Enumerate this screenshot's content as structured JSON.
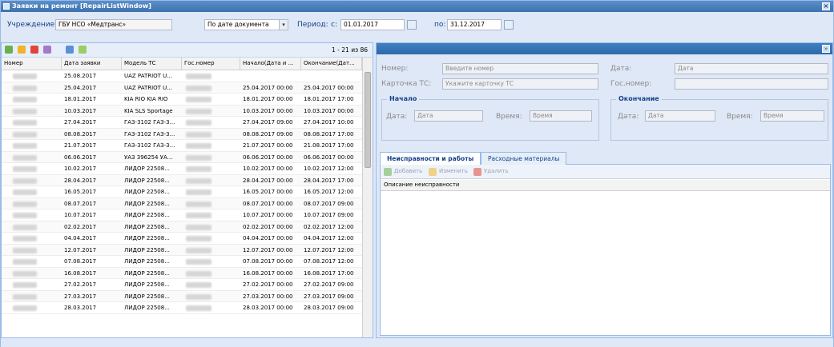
{
  "window": {
    "title": "Заявки на ремонт [RepairListWindow]"
  },
  "filter": {
    "institution_label": "Учреждение:",
    "institution_value": "ГБУ НСО «Медтранс»",
    "date_mode": "По дате документа",
    "period_label": "Период:",
    "from_label": "с:",
    "from_value": "01.01.2017",
    "to_label": "по:",
    "to_value": "31.12.2017"
  },
  "list": {
    "pager": "1 - 21 из 86",
    "columns": [
      "Номер",
      "Дата заявки",
      "Модель ТС",
      "Гос.номер",
      "Начало(Дата и ...",
      "Окончание(Дат..."
    ],
    "rows": [
      {
        "date": "25.08.2017",
        "model": "UAZ PATRIOT U...",
        "start": "",
        "end": ""
      },
      {
        "date": "25.04.2017",
        "model": "UAZ PATRIOT U...",
        "start": "25.04.2017 00:00",
        "end": "25.04.2017 00:00"
      },
      {
        "date": "18.01.2017",
        "model": "KIA RIO KIA RIO",
        "start": "18.01.2017 00:00",
        "end": "18.01.2017 17:00"
      },
      {
        "date": "10.03.2017",
        "model": "KIA SLS Sportage",
        "start": "10.03.2017 00:00",
        "end": "10.03.2017 00:00"
      },
      {
        "date": "27.04.2017",
        "model": "ГАЗ-3102 ГАЗ-3...",
        "start": "27.04.2017 09:00",
        "end": "27.04.2017 10:00"
      },
      {
        "date": "08.08.2017",
        "model": "ГАЗ-3102 ГАЗ-3...",
        "start": "08.08.2017 09:00",
        "end": "08.08.2017 17:00"
      },
      {
        "date": "21.07.2017",
        "model": "ГАЗ-3102 ГАЗ-3...",
        "start": "21.07.2017 00:00",
        "end": "21.08.2017 17:00"
      },
      {
        "date": "06.06.2017",
        "model": "УАЗ 396254 УА...",
        "start": "06.06.2017 00:00",
        "end": "06.06.2017 00:00"
      },
      {
        "date": "10.02.2017",
        "model": "ЛИДОР 22508...",
        "start": "10.02.2017 00:00",
        "end": "10.02.2017 12:00"
      },
      {
        "date": "28.04.2017",
        "model": "ЛИДОР 22508...",
        "start": "28.04.2017 00:00",
        "end": "28.04.2017 17:00"
      },
      {
        "date": "16.05.2017",
        "model": "ЛИДОР 22508...",
        "start": "16.05.2017 00:00",
        "end": "16.05.2017 12:00"
      },
      {
        "date": "08.07.2017",
        "model": "ЛИДОР 22508...",
        "start": "08.07.2017 00:00",
        "end": "08.07.2017 09:00"
      },
      {
        "date": "10.07.2017",
        "model": "ЛИДОР 22508...",
        "start": "10.07.2017 00:00",
        "end": "10.07.2017 09:00"
      },
      {
        "date": "02.02.2017",
        "model": "ЛИДОР 22508...",
        "start": "02.02.2017 00:00",
        "end": "02.02.2017 12:00"
      },
      {
        "date": "04.04.2017",
        "model": "ЛИДОР 22508...",
        "start": "04.04.2017 00:00",
        "end": "04.04.2017 12:00"
      },
      {
        "date": "12.07.2017",
        "model": "ЛИДОР 22508...",
        "start": "12.07.2017 00:00",
        "end": "12.07.2017 12:00"
      },
      {
        "date": "07.08.2017",
        "model": "ЛИДОР 22508...",
        "start": "07.08.2017 00:00",
        "end": "07.08.2017 12:00"
      },
      {
        "date": "16.08.2017",
        "model": "ЛИДОР 22508...",
        "start": "16.08.2017 00:00",
        "end": "16.08.2017 17:00"
      },
      {
        "date": "27.02.2017",
        "model": "ЛИДОР 22508...",
        "start": "27.02.2017 00:00",
        "end": "27.02.2017 09:00"
      },
      {
        "date": "27.03.2017",
        "model": "ЛИДОР 22508...",
        "start": "27.03.2017 00:00",
        "end": "27.03.2017 09:00"
      },
      {
        "date": "28.03.2017",
        "model": "ЛИДОР 22508...",
        "start": "28.03.2017 00:00",
        "end": "28.03.2017 09:00"
      }
    ]
  },
  "detail": {
    "number_label": "Номер:",
    "number_placeholder": "Введите номер",
    "card_label": "Карточка ТС:",
    "card_placeholder": "Укажите карточку ТС",
    "date_label": "Дата:",
    "date_placeholder": "Дата",
    "gos_label": "Гос.номер:",
    "start_title": "Начало",
    "end_title": "Окончание",
    "start_date_label": "Дата:",
    "start_date_placeholder": "Дата",
    "start_time_label": "Время:",
    "start_time_placeholder": "Время",
    "end_date_label": "Дата:",
    "end_date_placeholder": "Дата",
    "end_time_label": "Время:",
    "end_time_placeholder": "Время",
    "tabs": [
      "Неисправности и работы",
      "Расходные материалы"
    ],
    "add_label": "Добавить",
    "edit_label": "Изменить",
    "delete_label": "Удалить",
    "faults_column": "Описание неисправности"
  },
  "colors": {
    "accent": "#3d72ad",
    "panel": "#dfe8f6",
    "border": "#99bbe8"
  }
}
